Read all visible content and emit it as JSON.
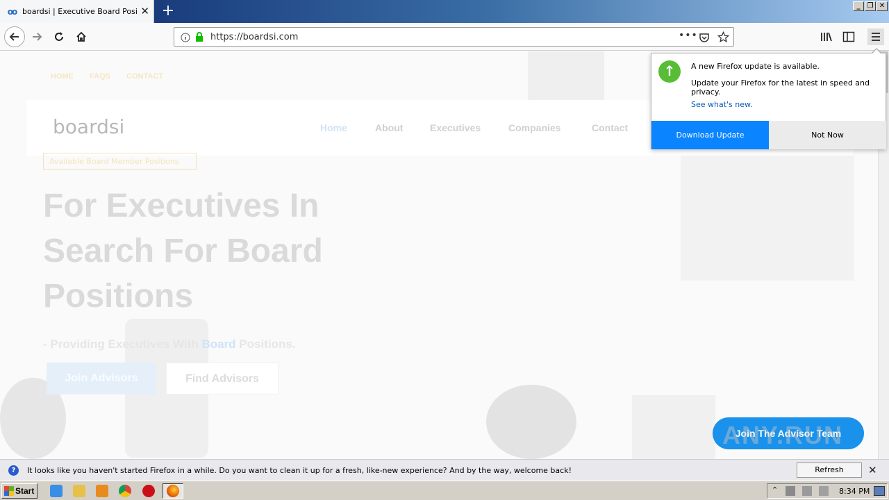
{
  "window": {
    "tab_title": "boardsi | Executive Board Position",
    "favicon": "boardsi-icon",
    "new_tab_symbol": "+",
    "close_symbol": "✕",
    "minimize_symbol": "_",
    "restore_symbol": "❐",
    "close_window_symbol": "✕"
  },
  "navbar": {
    "url": "https://boardsi.com",
    "icons": [
      "back-icon",
      "forward-icon",
      "reload-icon",
      "home-icon",
      "info-icon",
      "lock-icon",
      "page-actions-icon",
      "pocket-icon",
      "bookmark-star-icon",
      "library-icon",
      "sidebar-icon",
      "menu-icon"
    ]
  },
  "site": {
    "top_links": [
      "HOME",
      "FAQS",
      "CONTACT"
    ],
    "logo": "boardsi",
    "nav": [
      "Home",
      "About",
      "Executives",
      "Companies",
      "Contact"
    ],
    "badge": "Available Board Member Positions",
    "hero_title": "For Executives In Search For Board Positions",
    "subtitle_prefix": "- Providing Executives With ",
    "subtitle_highlight": "Board",
    "subtitle_suffix": " Positions.",
    "join_button": "Join Advisors",
    "find_button": "Find Advisors",
    "cta_button": "Join The Advisor Team",
    "accent_color": "#1a91ea"
  },
  "update_popup": {
    "title": "A new Firefox update is available.",
    "body": "Update your Firefox for the latest in speed and privacy.",
    "link": "See what's new.",
    "download_label": "Download Update",
    "not_now_label": "Not Now",
    "icon": "update-arrow-icon"
  },
  "notification": {
    "text": "It looks like you haven't started Firefox in a while. Do you want to clean it up for a fresh, like-new experience? And by the way, welcome back!",
    "refresh_label": "Refresh Firefox…"
  },
  "taskbar": {
    "start_label": "Start",
    "clock": "8:34 PM",
    "apps": [
      "ie-icon",
      "explorer-icon",
      "media-player-icon",
      "chrome-icon",
      "opera-icon",
      "firefox-icon"
    ]
  },
  "watermark": "ANY.RUN"
}
